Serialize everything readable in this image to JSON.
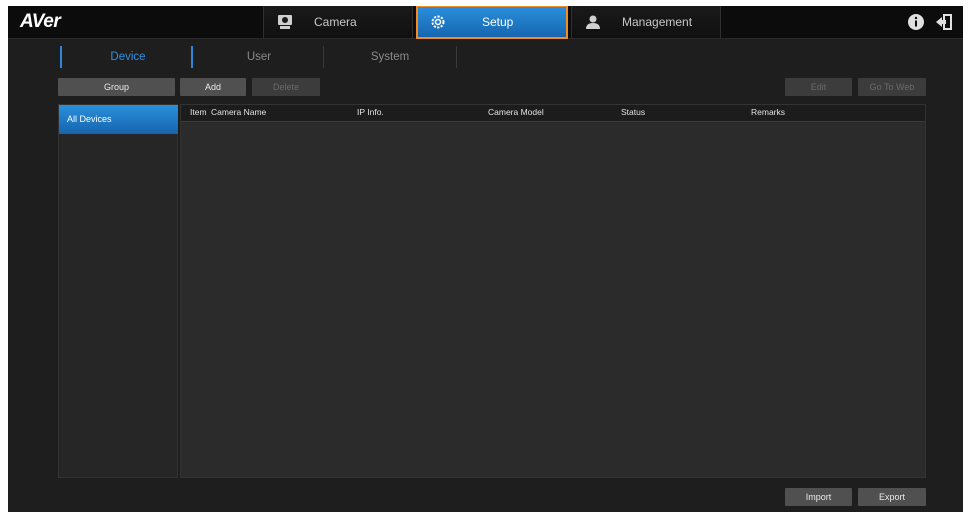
{
  "app": {
    "logo": "AVer"
  },
  "main_tabs": [
    {
      "label": "Camera",
      "icon": "camera-icon",
      "active": false
    },
    {
      "label": "Setup",
      "icon": "gear-icon",
      "active": true
    },
    {
      "label": "Management",
      "icon": "user-icon",
      "active": false
    }
  ],
  "top_icons": [
    "info-icon",
    "logout-icon"
  ],
  "sub_tabs": [
    {
      "label": "Device",
      "active": true
    },
    {
      "label": "User",
      "active": false
    },
    {
      "label": "System",
      "active": false
    }
  ],
  "toolbar": {
    "group": "Group",
    "add": "Add",
    "delete": "Delete",
    "edit": "Edit",
    "go_to_web": "Go To Web"
  },
  "tree": {
    "all_devices": "All Devices"
  },
  "table": {
    "columns": [
      "Item",
      "Camera Name",
      "IP Info.",
      "Camera Model",
      "Status",
      "Remarks"
    ],
    "rows": []
  },
  "footer": {
    "import": "Import",
    "export": "Export"
  },
  "colors": {
    "accent": "#1e7bc8",
    "highlight_outline": "#f28c28",
    "background": "#1e1e1e"
  }
}
